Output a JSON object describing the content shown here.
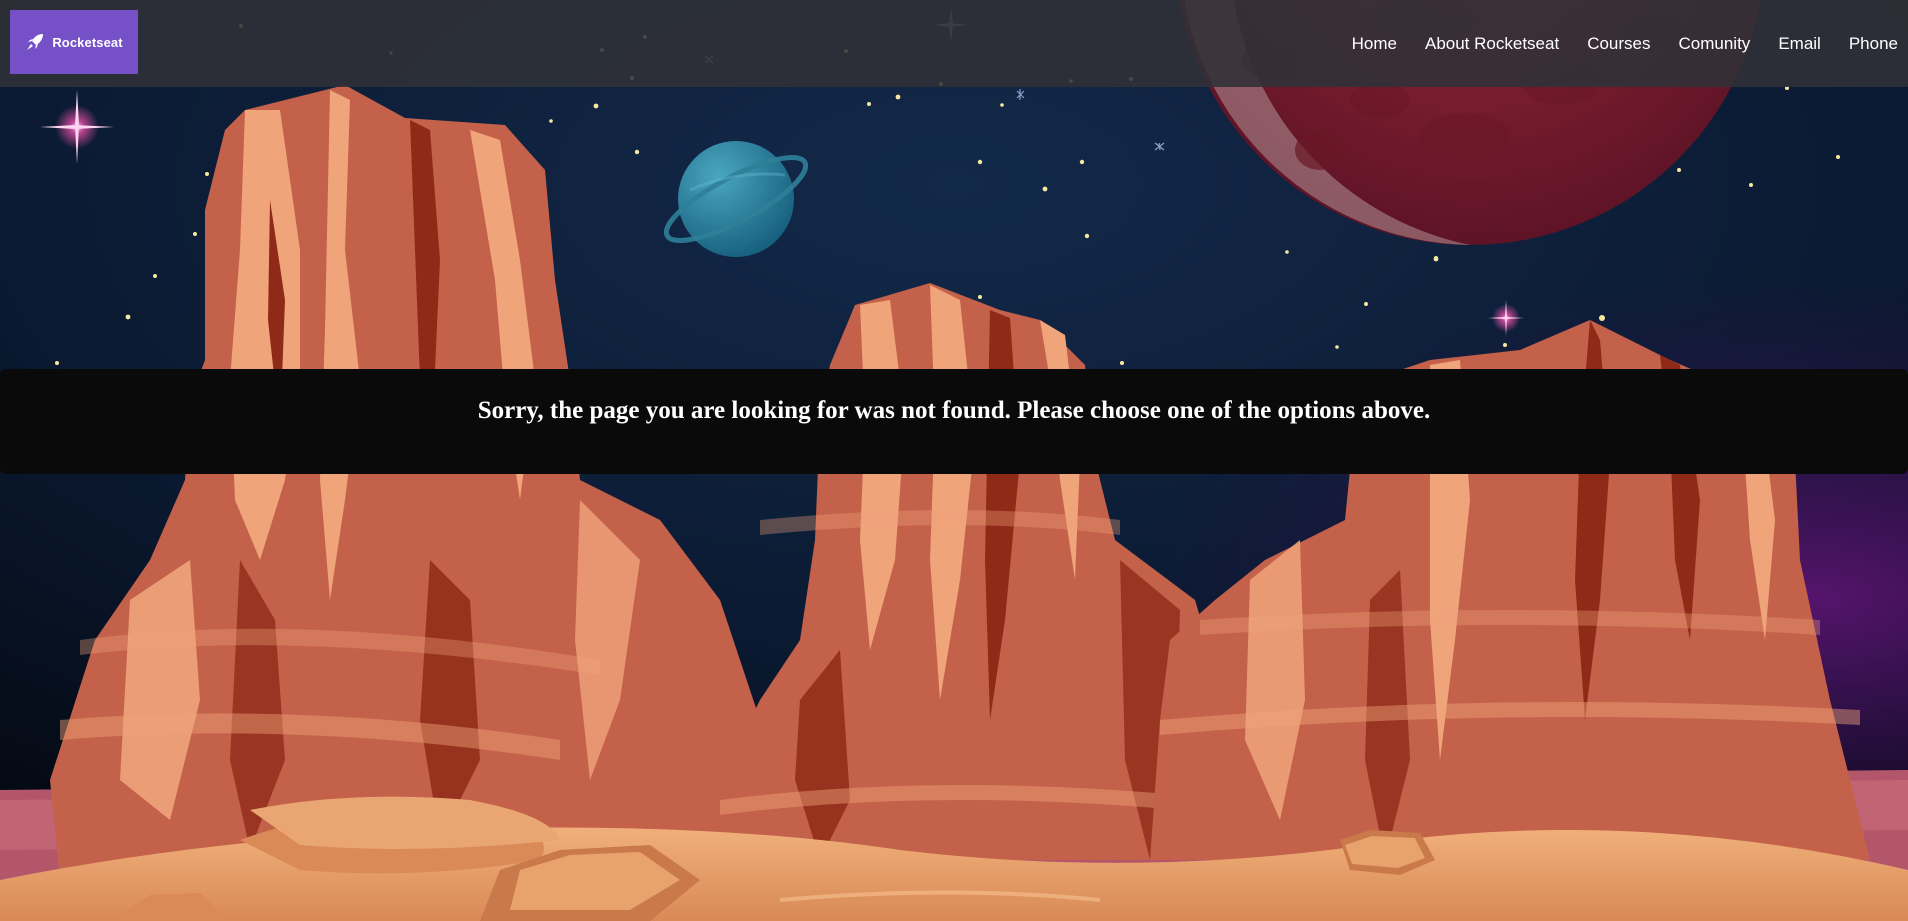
{
  "brand": {
    "name": "Rocketseat",
    "color": "#7550c6",
    "icon": "rocket-icon"
  },
  "nav": {
    "links": [
      {
        "label": "Home"
      },
      {
        "label": "About Rocketseat"
      },
      {
        "label": "Courses"
      },
      {
        "label": "Comunity"
      },
      {
        "label": "Email"
      },
      {
        "label": "Phone"
      }
    ]
  },
  "message": {
    "text": "Sorry, the page you are looking for was not found. Please choose one of the options above."
  },
  "colors": {
    "sky_dark": "#0a1628",
    "sky_purple": "#3a0f55",
    "rock": "#c4614a",
    "rock_light": "#f0a47a",
    "rock_dark": "#8f2a18",
    "sand": "#e8a26c",
    "planet_blue": "#1f6f8b",
    "moon_red": "#7a1e2c"
  }
}
